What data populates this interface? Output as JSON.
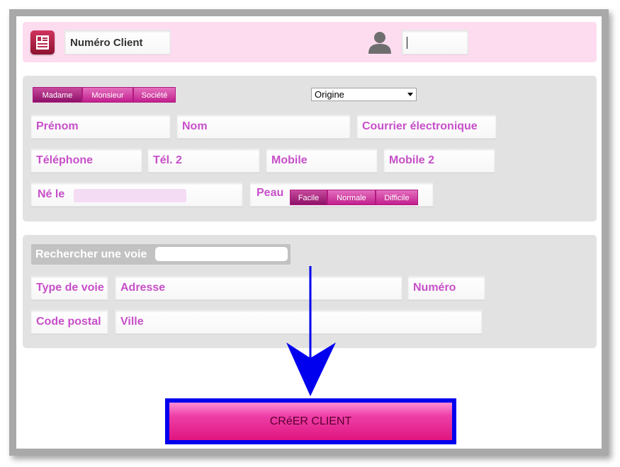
{
  "header": {
    "client_number_label": "Numéro Client",
    "user_field_value": ""
  },
  "identity": {
    "civility_options": [
      "Madame",
      "Monsieur",
      "Société"
    ],
    "civility_selected": "Madame",
    "origin_select": "Origine",
    "first_name": "Prénom",
    "last_name": "Nom",
    "email": "Courrier électronique",
    "phone": "Téléphone",
    "phone2": "Tél. 2",
    "mobile": "Mobile",
    "mobile2": "Mobile 2",
    "born_label": "Né le",
    "born_value": "",
    "skin_label": "Peau",
    "skin_options": [
      "Facile",
      "Normale",
      "Difficile"
    ],
    "skin_selected": "Facile"
  },
  "address": {
    "search_label": "Rechercher une voie",
    "search_value": "",
    "street_type": "Type de voie",
    "address": "Adresse",
    "number": "Numéro",
    "postal_code": "Code postal",
    "city": "Ville"
  },
  "actions": {
    "create_client": "CRéER CLIENT"
  },
  "colors": {
    "accent": "#c74fc9",
    "brand": "#e0157f",
    "header_bg": "#fddcf0",
    "panel_bg": "#e2e2e2",
    "annotation": "#0000ff"
  }
}
